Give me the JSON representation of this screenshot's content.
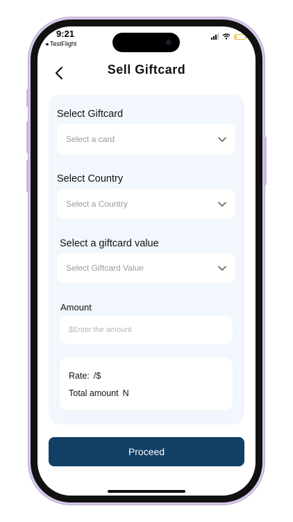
{
  "status_bar": {
    "time": "9:21",
    "back_app": "◂ TestFlight",
    "battery_color": "#e4b43a"
  },
  "header": {
    "back_icon": "chevron-left-icon",
    "title": "Sell Giftcard"
  },
  "form": {
    "giftcard": {
      "label": "Select Giftcard",
      "placeholder": "Select a card"
    },
    "country": {
      "label": "Select Country",
      "placeholder": "Select a Country"
    },
    "value": {
      "label": "Select a giftcard value",
      "placeholder": "Select Giftcard Value"
    },
    "amount": {
      "label": "Amount",
      "placeholder": "$Enter the amount",
      "value": ""
    },
    "summary": {
      "rate_label": "Rate:",
      "rate_value": "/$",
      "total_label": "Total amount",
      "total_value": "N"
    }
  },
  "actions": {
    "proceed_label": "Proceed",
    "proceed_color": "#123f66"
  },
  "colors": {
    "card_background": "#f1f7fc",
    "phone_frame": "#d9c9ec"
  }
}
